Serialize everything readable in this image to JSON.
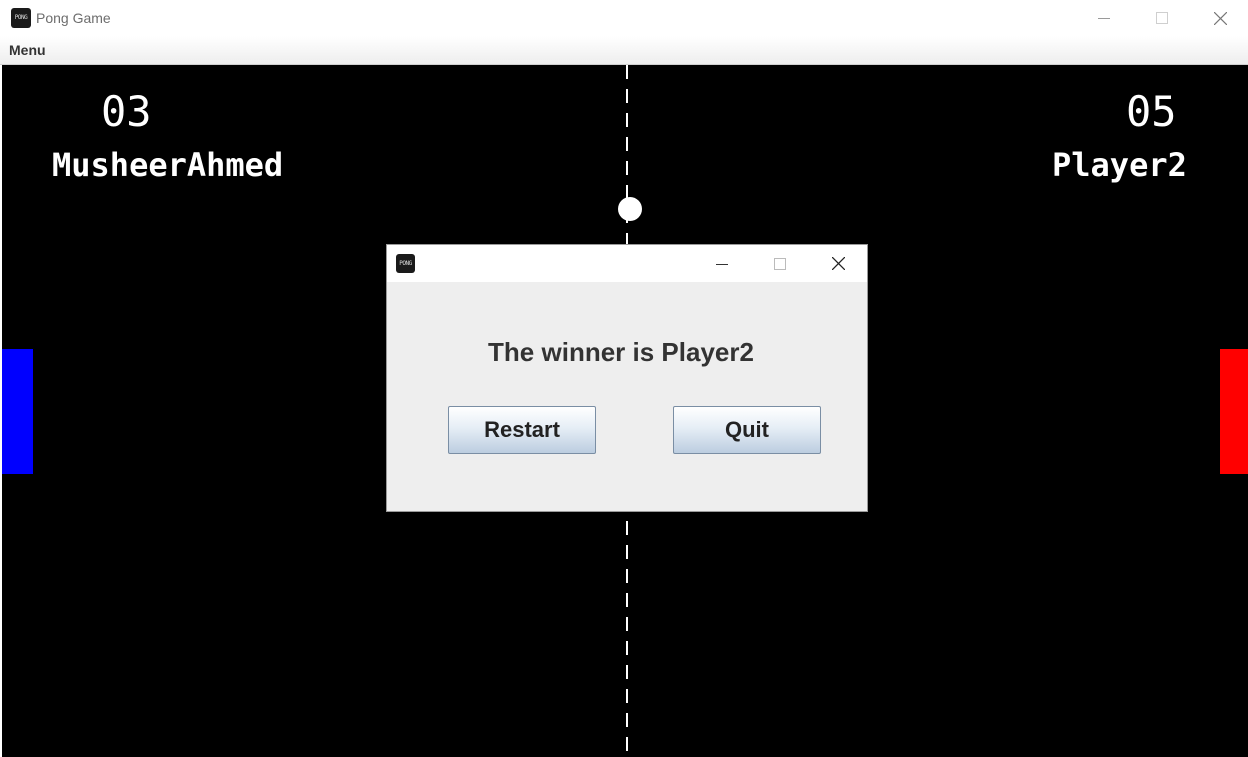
{
  "window": {
    "title": "Pong Game",
    "icon_name": "pong-app-icon",
    "icon_text": "PONG"
  },
  "menubar": {
    "items": [
      {
        "label": "Menu"
      }
    ]
  },
  "game": {
    "left_player": {
      "score": "03",
      "name": "MusheerAhmed",
      "paddle_color": "#0000ff"
    },
    "right_player": {
      "score": "05",
      "name": "Player2",
      "paddle_color": "#ff0000"
    },
    "background_color": "#000000",
    "ball_color": "#ffffff"
  },
  "dialog": {
    "icon_text": "PONG",
    "message": "The winner is Player2",
    "buttons": {
      "restart": "Restart",
      "quit": "Quit"
    }
  }
}
